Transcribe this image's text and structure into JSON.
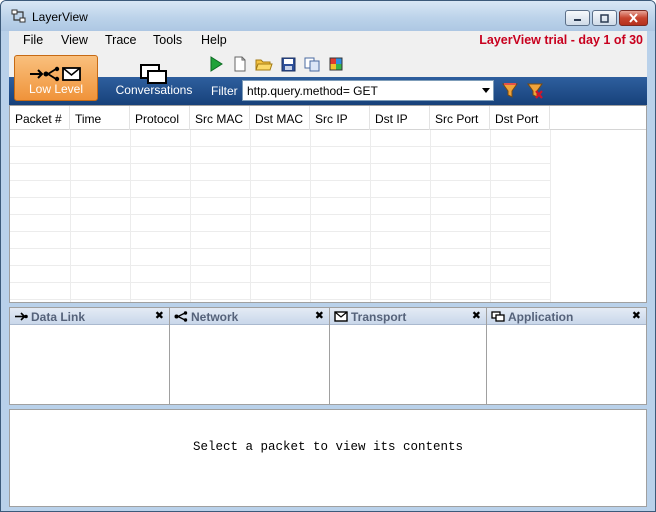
{
  "window": {
    "title": "LayerView",
    "controls": {
      "minimize": "minimize",
      "maximize": "maximize",
      "close": "close"
    }
  },
  "menu": {
    "items": [
      "File",
      "View",
      "Trace",
      "Tools",
      "Help"
    ],
    "trial_notice": "LayerView trial - day 1 of 30"
  },
  "toolbar": {
    "modes": [
      {
        "label": "Low Level",
        "selected": true
      },
      {
        "label": "Conversations",
        "selected": false
      }
    ],
    "tools": [
      "play-icon",
      "new-file-icon",
      "open-folder-icon",
      "save-icon",
      "copy-icon",
      "color-icon"
    ],
    "filter_label": "Filter",
    "filter_value": "http.query.method= GET",
    "filter_apply": "apply-filter-icon",
    "filter_clear": "clear-filter-icon"
  },
  "packet_table": {
    "columns": [
      "Packet #",
      "Time",
      "Protocol",
      "Src MAC",
      "Dst MAC",
      "Src IP",
      "Dst IP",
      "Src Port",
      "Dst Port"
    ],
    "rows": []
  },
  "layers": [
    {
      "title": "Data Link",
      "icon": "data-link-icon"
    },
    {
      "title": "Network",
      "icon": "network-icon"
    },
    {
      "title": "Transport",
      "icon": "envelope-icon"
    },
    {
      "title": "Application",
      "icon": "windows-icon"
    }
  ],
  "contents": {
    "message": "Select a packet to view its contents"
  },
  "colors": {
    "accent": "#17417a",
    "trial": "#c8001e",
    "selected_tab": "#f0933a"
  }
}
